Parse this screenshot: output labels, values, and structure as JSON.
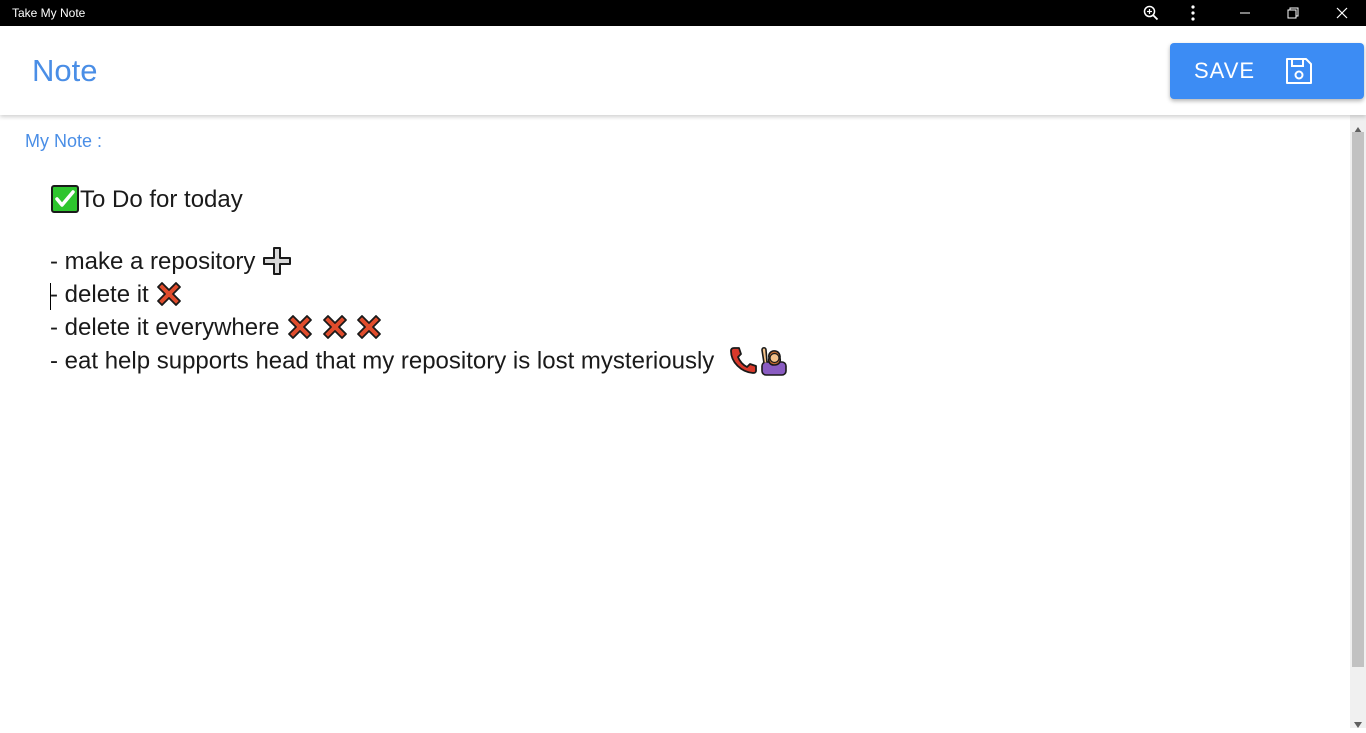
{
  "window": {
    "title": "Take My Note",
    "controls": [
      "zoom-icon",
      "more-icon",
      "minimize-icon",
      "restore-icon",
      "close-icon"
    ]
  },
  "header": {
    "title": "Note",
    "save_label": "SAVE"
  },
  "note": {
    "label": "My Note :",
    "lines": [
      "To Do for today",
      "- make a repository",
      "- delete it",
      "- delete it everywhere",
      "- eat help supports head that my repository is lost mysteriously"
    ]
  },
  "colors": {
    "accent": "#4a8ee6",
    "button": "#3c8cf4",
    "titlebar": "#000000"
  }
}
